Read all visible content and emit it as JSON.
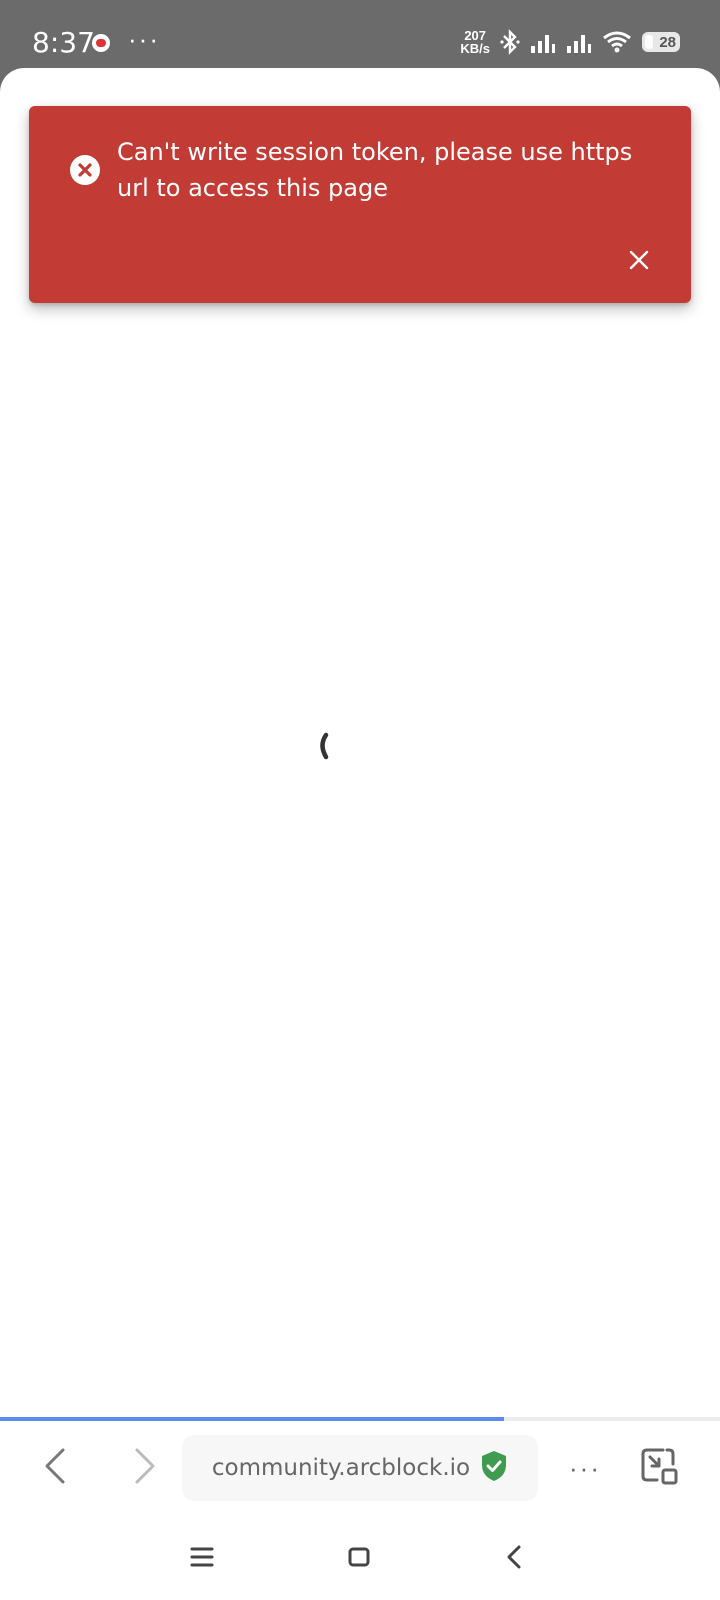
{
  "status_bar": {
    "time": "8:37",
    "more": "···",
    "net_speed_value": "207",
    "net_speed_unit": "KB/s",
    "battery_level": "28"
  },
  "toast": {
    "message": "Can't write session token, please use https url to access this page",
    "background": "#c23b34",
    "icon": "error-circle-icon",
    "close_icon": "close-icon"
  },
  "browser": {
    "url": "community.arcblock.io",
    "secure_icon": "shield-check-icon",
    "secure_color": "#3e9b4f",
    "menu": "···",
    "progress_fraction": 0.7
  },
  "system_nav": {
    "recent_icon": "menu-lines-icon",
    "home_icon": "square-icon",
    "back_icon": "chevron-left-icon"
  }
}
